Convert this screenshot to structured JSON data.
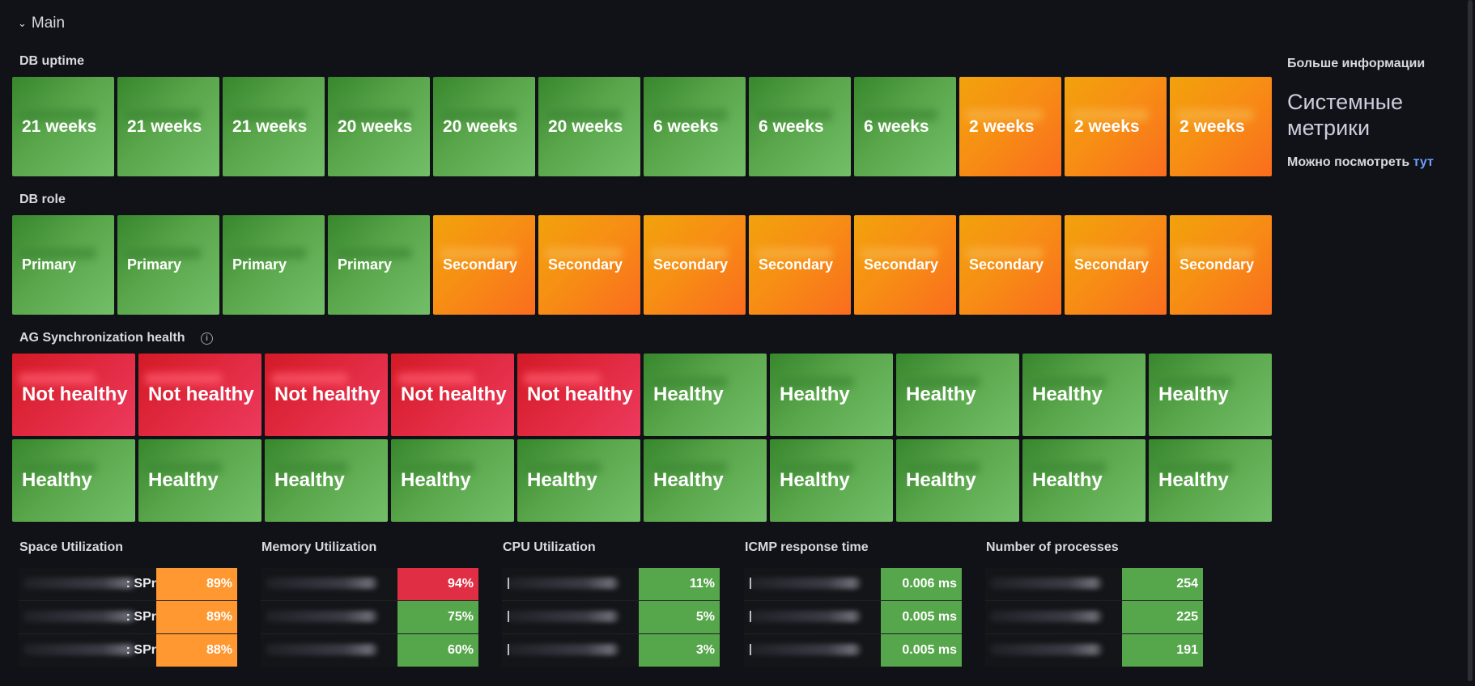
{
  "row": {
    "title": "Main",
    "collapse_icon": "chevron-down-icon"
  },
  "panels": {
    "db_uptime": {
      "title": "DB uptime",
      "values": [
        "21 weeks",
        "21 weeks",
        "21 weeks",
        "20 weeks",
        "20 weeks",
        "20 weeks",
        "6 weeks",
        "6 weeks",
        "6 weeks",
        "2 weeks",
        "2 weeks",
        "2 weeks"
      ],
      "colors": [
        "green",
        "green",
        "green",
        "green",
        "green",
        "green",
        "green",
        "green",
        "green",
        "orange",
        "orange",
        "orange"
      ]
    },
    "db_role": {
      "title": "DB role",
      "values": [
        "Primary",
        "Primary",
        "Primary",
        "Primary",
        "Secondary",
        "Secondary",
        "Secondary",
        "Secondary",
        "Secondary",
        "Secondary",
        "Secondary",
        "Secondary"
      ],
      "colors": [
        "green",
        "green",
        "green",
        "green",
        "orange",
        "orange",
        "orange",
        "orange",
        "orange",
        "orange",
        "orange",
        "orange"
      ]
    },
    "ag_health": {
      "title": "AG Synchronization health",
      "info_icon": "info-icon",
      "values": [
        "Not healthy",
        "Not healthy",
        "Not healthy",
        "Not healthy",
        "Not healthy",
        "Healthy",
        "Healthy",
        "Healthy",
        "Healthy",
        "Healthy",
        "Healthy",
        "Healthy",
        "Healthy",
        "Healthy",
        "Healthy",
        "Healthy",
        "Healthy",
        "Healthy",
        "Healthy",
        "Healthy"
      ],
      "colors": [
        "red",
        "red",
        "red",
        "red",
        "red",
        "green",
        "green",
        "green",
        "green",
        "green",
        "green",
        "green",
        "green",
        "green",
        "green",
        "green",
        "green",
        "green",
        "green",
        "green"
      ]
    },
    "space": {
      "title": "Space Utilization",
      "rows": [
        {
          "name": ": SPr",
          "value": "89%",
          "color": "orange"
        },
        {
          "name": ": SPr",
          "value": "89%",
          "color": "orange"
        },
        {
          "name": ": SPr",
          "value": "88%",
          "color": "orange"
        }
      ]
    },
    "memory": {
      "title": "Memory Utilization",
      "rows": [
        {
          "name": "",
          "value": "94%",
          "color": "red"
        },
        {
          "name": "",
          "value": "75%",
          "color": "green"
        },
        {
          "name": "",
          "value": "60%",
          "color": "green"
        }
      ]
    },
    "cpu": {
      "title": "CPU Utilization",
      "rows": [
        {
          "name": "",
          "value": "11%",
          "color": "green"
        },
        {
          "name": "",
          "value": "5%",
          "color": "green"
        },
        {
          "name": "",
          "value": "3%",
          "color": "green"
        }
      ]
    },
    "icmp": {
      "title": "ICMP response time",
      "rows": [
        {
          "name": "",
          "value": "0.006 ms",
          "color": "green"
        },
        {
          "name": "",
          "value": "0.005 ms",
          "color": "green"
        },
        {
          "name": "",
          "value": "0.005 ms",
          "color": "green"
        }
      ]
    },
    "processes": {
      "title": "Number of processes",
      "rows": [
        {
          "name": "",
          "value": "254",
          "color": "green"
        },
        {
          "name": "",
          "value": "225",
          "color": "green"
        },
        {
          "name": "",
          "value": "191",
          "color": "green"
        }
      ]
    },
    "info": {
      "title": "Больше информации",
      "heading": "Системные метрики",
      "text": "Можно посмотреть ",
      "link": "тут"
    }
  },
  "colors": {
    "green": "#56a64b",
    "orange": "#ff9830",
    "red": "#e02f44",
    "link": "#6e9fff",
    "background": "#111217"
  }
}
